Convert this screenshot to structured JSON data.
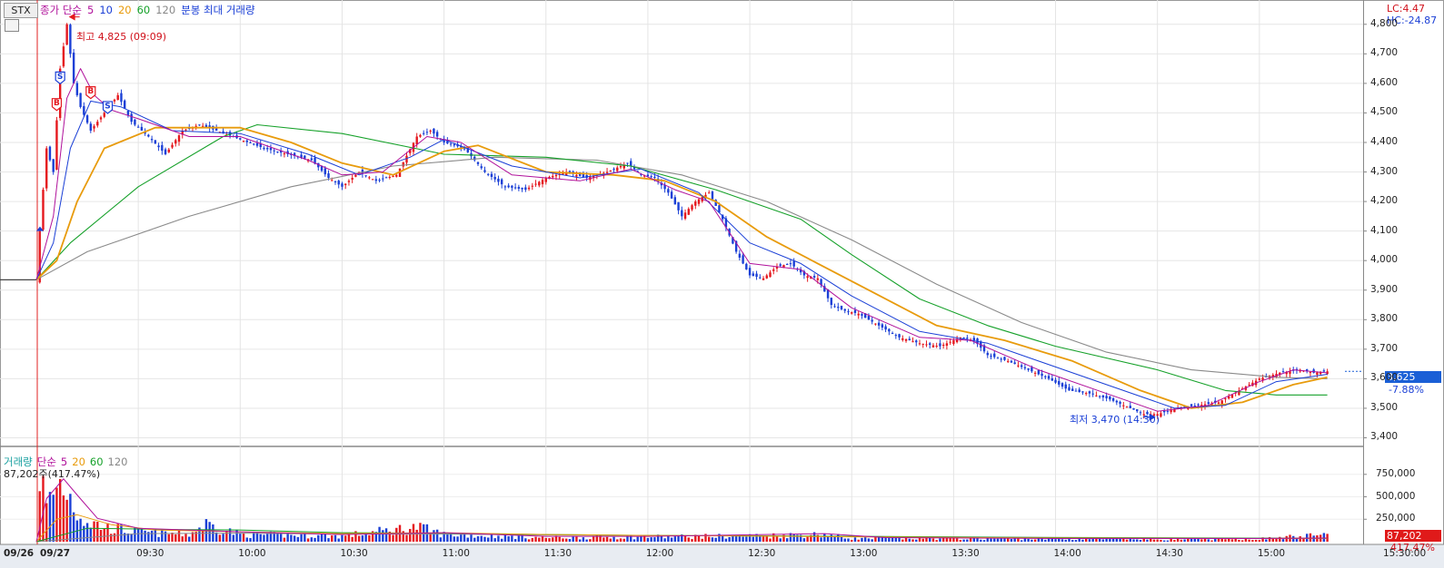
{
  "header": {
    "symbol": "STX",
    "indicators": [
      {
        "text": "종가 단순",
        "color": "#b0119b"
      },
      {
        "text": "5",
        "color": "#b0119b"
      },
      {
        "text": "10",
        "color": "#1a3fd6"
      },
      {
        "text": "20",
        "color": "#e89b0c"
      },
      {
        "text": "60",
        "color": "#16a12a"
      },
      {
        "text": "120",
        "color": "#888888"
      },
      {
        "text": "분봉 최대 거래량",
        "color": "#1a3fd6"
      }
    ],
    "lc": "LC:4.47",
    "hc": "HC:-24.87"
  },
  "price_axis": {
    "ticks": [
      "4,800",
      "4,700",
      "4,600",
      "4,500",
      "4,400",
      "4,300",
      "4,200",
      "4,100",
      "4,000",
      "3,900",
      "3,800",
      "3,700",
      "3,600",
      "3,500",
      "3,400"
    ],
    "current_price": "3,625",
    "current_change": "-7.88%"
  },
  "annotations": {
    "high": "최고 4,825 (09:09)",
    "low": "최저 3,470 (14:30)"
  },
  "volume_panel": {
    "title_parts": [
      {
        "text": "거래량",
        "color": "#1aa0a0"
      },
      {
        "text": "단순",
        "color": "#b0119b"
      },
      {
        "text": "5",
        "color": "#b0119b"
      },
      {
        "text": "20",
        "color": "#e89b0c"
      },
      {
        "text": "60",
        "color": "#16a12a"
      },
      {
        "text": "120",
        "color": "#888888"
      }
    ],
    "current_text": "87,202주(417.47%)",
    "ticks": [
      "750,000",
      "500,000",
      "250,000"
    ],
    "current_volume": "87,202",
    "current_pct": "417.47%"
  },
  "time_axis": {
    "ticks": [
      "09/26",
      "09/27",
      "09:30",
      "10:00",
      "10:30",
      "11:00",
      "11:30",
      "12:00",
      "12:30",
      "13:00",
      "13:30",
      "14:00",
      "14:30",
      "15:00",
      "15:30:00"
    ]
  },
  "chart_data": {
    "type": "candlestick",
    "y_range": [
      3380,
      4870
    ],
    "volume_range": [
      0,
      950000
    ],
    "previous_close": 3935,
    "high": 4825,
    "low": 3470,
    "last": 3625,
    "price_path": [
      [
        "09:00",
        3935
      ],
      [
        "09:01",
        4100
      ],
      [
        "09:03",
        4380
      ],
      [
        "09:05",
        4300
      ],
      [
        "09:07",
        4650
      ],
      [
        "09:09",
        4800
      ],
      [
        "09:11",
        4600
      ],
      [
        "09:13",
        4520
      ],
      [
        "09:16",
        4440
      ],
      [
        "09:20",
        4500
      ],
      [
        "09:24",
        4560
      ],
      [
        "09:28",
        4470
      ],
      [
        "09:33",
        4420
      ],
      [
        "09:38",
        4360
      ],
      [
        "09:43",
        4440
      ],
      [
        "09:48",
        4460
      ],
      [
        "09:53",
        4440
      ],
      [
        "10:00",
        4410
      ],
      [
        "10:07",
        4380
      ],
      [
        "10:14",
        4360
      ],
      [
        "10:21",
        4340
      ],
      [
        "10:26",
        4280
      ],
      [
        "10:30",
        4250
      ],
      [
        "10:35",
        4300
      ],
      [
        "10:40",
        4270
      ],
      [
        "10:46",
        4290
      ],
      [
        "10:52",
        4420
      ],
      [
        "10:56",
        4440
      ],
      [
        "11:00",
        4400
      ],
      [
        "11:06",
        4380
      ],
      [
        "11:12",
        4300
      ],
      [
        "11:18",
        4250
      ],
      [
        "11:24",
        4240
      ],
      [
        "11:30",
        4280
      ],
      [
        "11:36",
        4300
      ],
      [
        "11:42",
        4280
      ],
      [
        "11:48",
        4300
      ],
      [
        "11:54",
        4330
      ],
      [
        "11:58",
        4290
      ],
      [
        "12:02",
        4280
      ],
      [
        "12:06",
        4230
      ],
      [
        "12:10",
        4150
      ],
      [
        "12:14",
        4200
      ],
      [
        "12:18",
        4230
      ],
      [
        "12:22",
        4140
      ],
      [
        "12:26",
        4030
      ],
      [
        "12:30",
        3950
      ],
      [
        "12:34",
        3940
      ],
      [
        "12:38",
        3980
      ],
      [
        "12:42",
        3990
      ],
      [
        "12:46",
        3950
      ],
      [
        "12:50",
        3940
      ],
      [
        "12:54",
        3850
      ],
      [
        "12:58",
        3830
      ],
      [
        "13:02",
        3820
      ],
      [
        "13:08",
        3780
      ],
      [
        "13:14",
        3740
      ],
      [
        "13:20",
        3720
      ],
      [
        "13:26",
        3710
      ],
      [
        "13:32",
        3740
      ],
      [
        "13:36",
        3730
      ],
      [
        "13:40",
        3680
      ],
      [
        "13:46",
        3660
      ],
      [
        "13:52",
        3630
      ],
      [
        "13:58",
        3600
      ],
      [
        "14:04",
        3560
      ],
      [
        "14:10",
        3550
      ],
      [
        "14:16",
        3530
      ],
      [
        "14:22",
        3500
      ],
      [
        "14:26",
        3480
      ],
      [
        "14:30",
        3480
      ],
      [
        "14:36",
        3500
      ],
      [
        "14:42",
        3510
      ],
      [
        "14:48",
        3520
      ],
      [
        "14:54",
        3560
      ],
      [
        "15:00",
        3600
      ],
      [
        "15:06",
        3620
      ],
      [
        "15:12",
        3630
      ],
      [
        "15:16",
        3620
      ],
      [
        "15:20",
        3625
      ]
    ],
    "ma5": [
      [
        "09:00",
        3935
      ],
      [
        "09:05",
        4150
      ],
      [
        "09:09",
        4550
      ],
      [
        "09:13",
        4650
      ],
      [
        "09:17",
        4560
      ],
      [
        "09:22",
        4510
      ],
      [
        "09:30",
        4480
      ],
      [
        "09:45",
        4420
      ],
      [
        "10:00",
        4420
      ],
      [
        "10:20",
        4340
      ],
      [
        "10:30",
        4290
      ],
      [
        "10:42",
        4300
      ],
      [
        "10:55",
        4420
      ],
      [
        "11:05",
        4400
      ],
      [
        "11:20",
        4290
      ],
      [
        "11:40",
        4270
      ],
      [
        "11:55",
        4310
      ],
      [
        "12:08",
        4240
      ],
      [
        "12:18",
        4200
      ],
      [
        "12:30",
        3990
      ],
      [
        "12:45",
        3970
      ],
      [
        "13:00",
        3840
      ],
      [
        "13:20",
        3740
      ],
      [
        "13:35",
        3730
      ],
      [
        "13:55",
        3630
      ],
      [
        "14:15",
        3550
      ],
      [
        "14:30",
        3490
      ],
      [
        "14:45",
        3510
      ],
      [
        "15:00",
        3590
      ],
      [
        "15:10",
        3630
      ],
      [
        "15:20",
        3620
      ]
    ],
    "ma10": [
      [
        "09:00",
        3935
      ],
      [
        "09:05",
        4060
      ],
      [
        "09:10",
        4380
      ],
      [
        "09:16",
        4540
      ],
      [
        "09:25",
        4520
      ],
      [
        "09:40",
        4440
      ],
      [
        "10:00",
        4430
      ],
      [
        "10:20",
        4360
      ],
      [
        "10:35",
        4290
      ],
      [
        "10:50",
        4350
      ],
      [
        "11:00",
        4410
      ],
      [
        "11:20",
        4320
      ],
      [
        "11:40",
        4280
      ],
      [
        "11:58",
        4310
      ],
      [
        "12:15",
        4230
      ],
      [
        "12:30",
        4060
      ],
      [
        "12:45",
        3990
      ],
      [
        "13:00",
        3880
      ],
      [
        "13:20",
        3760
      ],
      [
        "13:40",
        3720
      ],
      [
        "14:00",
        3640
      ],
      [
        "14:20",
        3560
      ],
      [
        "14:35",
        3500
      ],
      [
        "14:50",
        3510
      ],
      [
        "15:05",
        3590
      ],
      [
        "15:20",
        3615
      ]
    ],
    "ma20": [
      [
        "09:00",
        3935
      ],
      [
        "09:06",
        4000
      ],
      [
        "09:12",
        4200
      ],
      [
        "09:20",
        4380
      ],
      [
        "09:35",
        4450
      ],
      [
        "10:00",
        4450
      ],
      [
        "10:15",
        4400
      ],
      [
        "10:30",
        4330
      ],
      [
        "10:45",
        4290
      ],
      [
        "11:00",
        4370
      ],
      [
        "11:10",
        4390
      ],
      [
        "11:30",
        4300
      ],
      [
        "11:50",
        4290
      ],
      [
        "12:05",
        4270
      ],
      [
        "12:20",
        4200
      ],
      [
        "12:35",
        4080
      ],
      [
        "12:50",
        3990
      ],
      [
        "13:05",
        3900
      ],
      [
        "13:25",
        3780
      ],
      [
        "13:45",
        3730
      ],
      [
        "14:05",
        3660
      ],
      [
        "14:25",
        3560
      ],
      [
        "14:40",
        3500
      ],
      [
        "14:55",
        3520
      ],
      [
        "15:10",
        3580
      ],
      [
        "15:20",
        3605
      ]
    ],
    "ma60": [
      [
        "09:00",
        3935
      ],
      [
        "09:10",
        4060
      ],
      [
        "09:30",
        4250
      ],
      [
        "09:55",
        4420
      ],
      [
        "10:05",
        4460
      ],
      [
        "10:30",
        4430
      ],
      [
        "11:00",
        4360
      ],
      [
        "11:30",
        4350
      ],
      [
        "11:55",
        4320
      ],
      [
        "12:20",
        4240
      ],
      [
        "12:45",
        4140
      ],
      [
        "13:00",
        4020
      ],
      [
        "13:20",
        3870
      ],
      [
        "13:40",
        3780
      ],
      [
        "14:00",
        3710
      ],
      [
        "14:30",
        3630
      ],
      [
        "14:50",
        3560
      ],
      [
        "15:05",
        3545
      ],
      [
        "15:20",
        3545
      ]
    ],
    "ma120": [
      [
        "09:00",
        3935
      ],
      [
        "09:15",
        4030
      ],
      [
        "09:45",
        4150
      ],
      [
        "10:15",
        4250
      ],
      [
        "10:45",
        4320
      ],
      [
        "11:15",
        4350
      ],
      [
        "11:45",
        4340
      ],
      [
        "12:10",
        4290
      ],
      [
        "12:35",
        4200
      ],
      [
        "13:00",
        4070
      ],
      [
        "13:25",
        3920
      ],
      [
        "13:50",
        3790
      ],
      [
        "14:15",
        3690
      ],
      [
        "14:40",
        3630
      ],
      [
        "15:05",
        3605
      ],
      [
        "15:20",
        3600
      ]
    ],
    "markers": [
      {
        "label": "B",
        "time": "09:06",
        "price": 4530
      },
      {
        "label": "S",
        "time": "09:07",
        "price": 4620
      },
      {
        "label": "B",
        "time": "09:16",
        "price": 4570
      },
      {
        "label": "S",
        "time": "09:21",
        "price": 4520
      }
    ],
    "volume_path": [
      [
        "09:00",
        0
      ],
      [
        "09:01",
        880000
      ],
      [
        "09:03",
        420000
      ],
      [
        "09:05",
        600000
      ],
      [
        "09:07",
        720000
      ],
      [
        "09:09",
        650000
      ],
      [
        "09:12",
        380000
      ],
      [
        "09:15",
        250000
      ],
      [
        "09:20",
        180000
      ],
      [
        "09:30",
        120000
      ],
      [
        "09:45",
        90000
      ],
      [
        "09:50",
        220000
      ],
      [
        "10:00",
        90000
      ],
      [
        "10:30",
        70000
      ],
      [
        "10:52",
        180000
      ],
      [
        "11:00",
        90000
      ],
      [
        "11:30",
        50000
      ],
      [
        "12:00",
        60000
      ],
      [
        "12:30",
        70000
      ],
      [
        "12:52",
        90000
      ],
      [
        "13:00",
        40000
      ],
      [
        "13:30",
        40000
      ],
      [
        "14:00",
        35000
      ],
      [
        "14:30",
        30000
      ],
      [
        "15:00",
        35000
      ],
      [
        "15:20",
        87202
      ]
    ],
    "vol_ma5": [
      [
        "09:00",
        0
      ],
      [
        "09:03",
        480000
      ],
      [
        "09:08",
        700000
      ],
      [
        "09:12",
        520000
      ],
      [
        "09:18",
        260000
      ],
      [
        "09:30",
        150000
      ],
      [
        "10:00",
        110000
      ],
      [
        "10:30",
        80000
      ],
      [
        "11:00",
        100000
      ],
      [
        "11:30",
        60000
      ],
      [
        "12:00",
        60000
      ],
      [
        "12:52",
        90000
      ],
      [
        "13:10",
        45000
      ],
      [
        "14:00",
        35000
      ],
      [
        "15:00",
        35000
      ],
      [
        "15:20",
        40000
      ]
    ],
    "vol_ma20": [
      [
        "09:00",
        0
      ],
      [
        "09:06",
        250000
      ],
      [
        "09:12",
        300000
      ],
      [
        "09:22",
        190000
      ],
      [
        "09:35",
        130000
      ],
      [
        "10:00",
        110000
      ],
      [
        "10:30",
        90000
      ],
      [
        "11:00",
        100000
      ],
      [
        "11:30",
        80000
      ],
      [
        "12:00",
        70000
      ],
      [
        "13:00",
        55000
      ],
      [
        "14:00",
        40000
      ],
      [
        "15:00",
        35000
      ],
      [
        "15:20",
        38000
      ]
    ],
    "vol_ma60": [
      [
        "09:00",
        0
      ],
      [
        "09:15",
        150000
      ],
      [
        "09:40",
        135000
      ],
      [
        "10:00",
        130000
      ],
      [
        "10:30",
        100000
      ],
      [
        "11:00",
        95000
      ],
      [
        "11:30",
        80000
      ],
      [
        "12:00",
        70000
      ],
      [
        "13:00",
        60000
      ],
      [
        "14:00",
        45000
      ],
      [
        "15:00",
        38000
      ],
      [
        "15:20",
        38000
      ]
    ],
    "vol_ma120": [
      [
        "09:00",
        0
      ],
      [
        "09:30",
        90000
      ],
      [
        "10:00",
        95000
      ],
      [
        "10:30",
        85000
      ],
      [
        "11:00",
        85000
      ],
      [
        "11:30",
        75000
      ],
      [
        "12:00",
        70000
      ],
      [
        "13:00",
        60000
      ],
      [
        "14:00",
        48000
      ],
      [
        "15:00",
        40000
      ],
      [
        "15:20",
        40000
      ]
    ]
  }
}
